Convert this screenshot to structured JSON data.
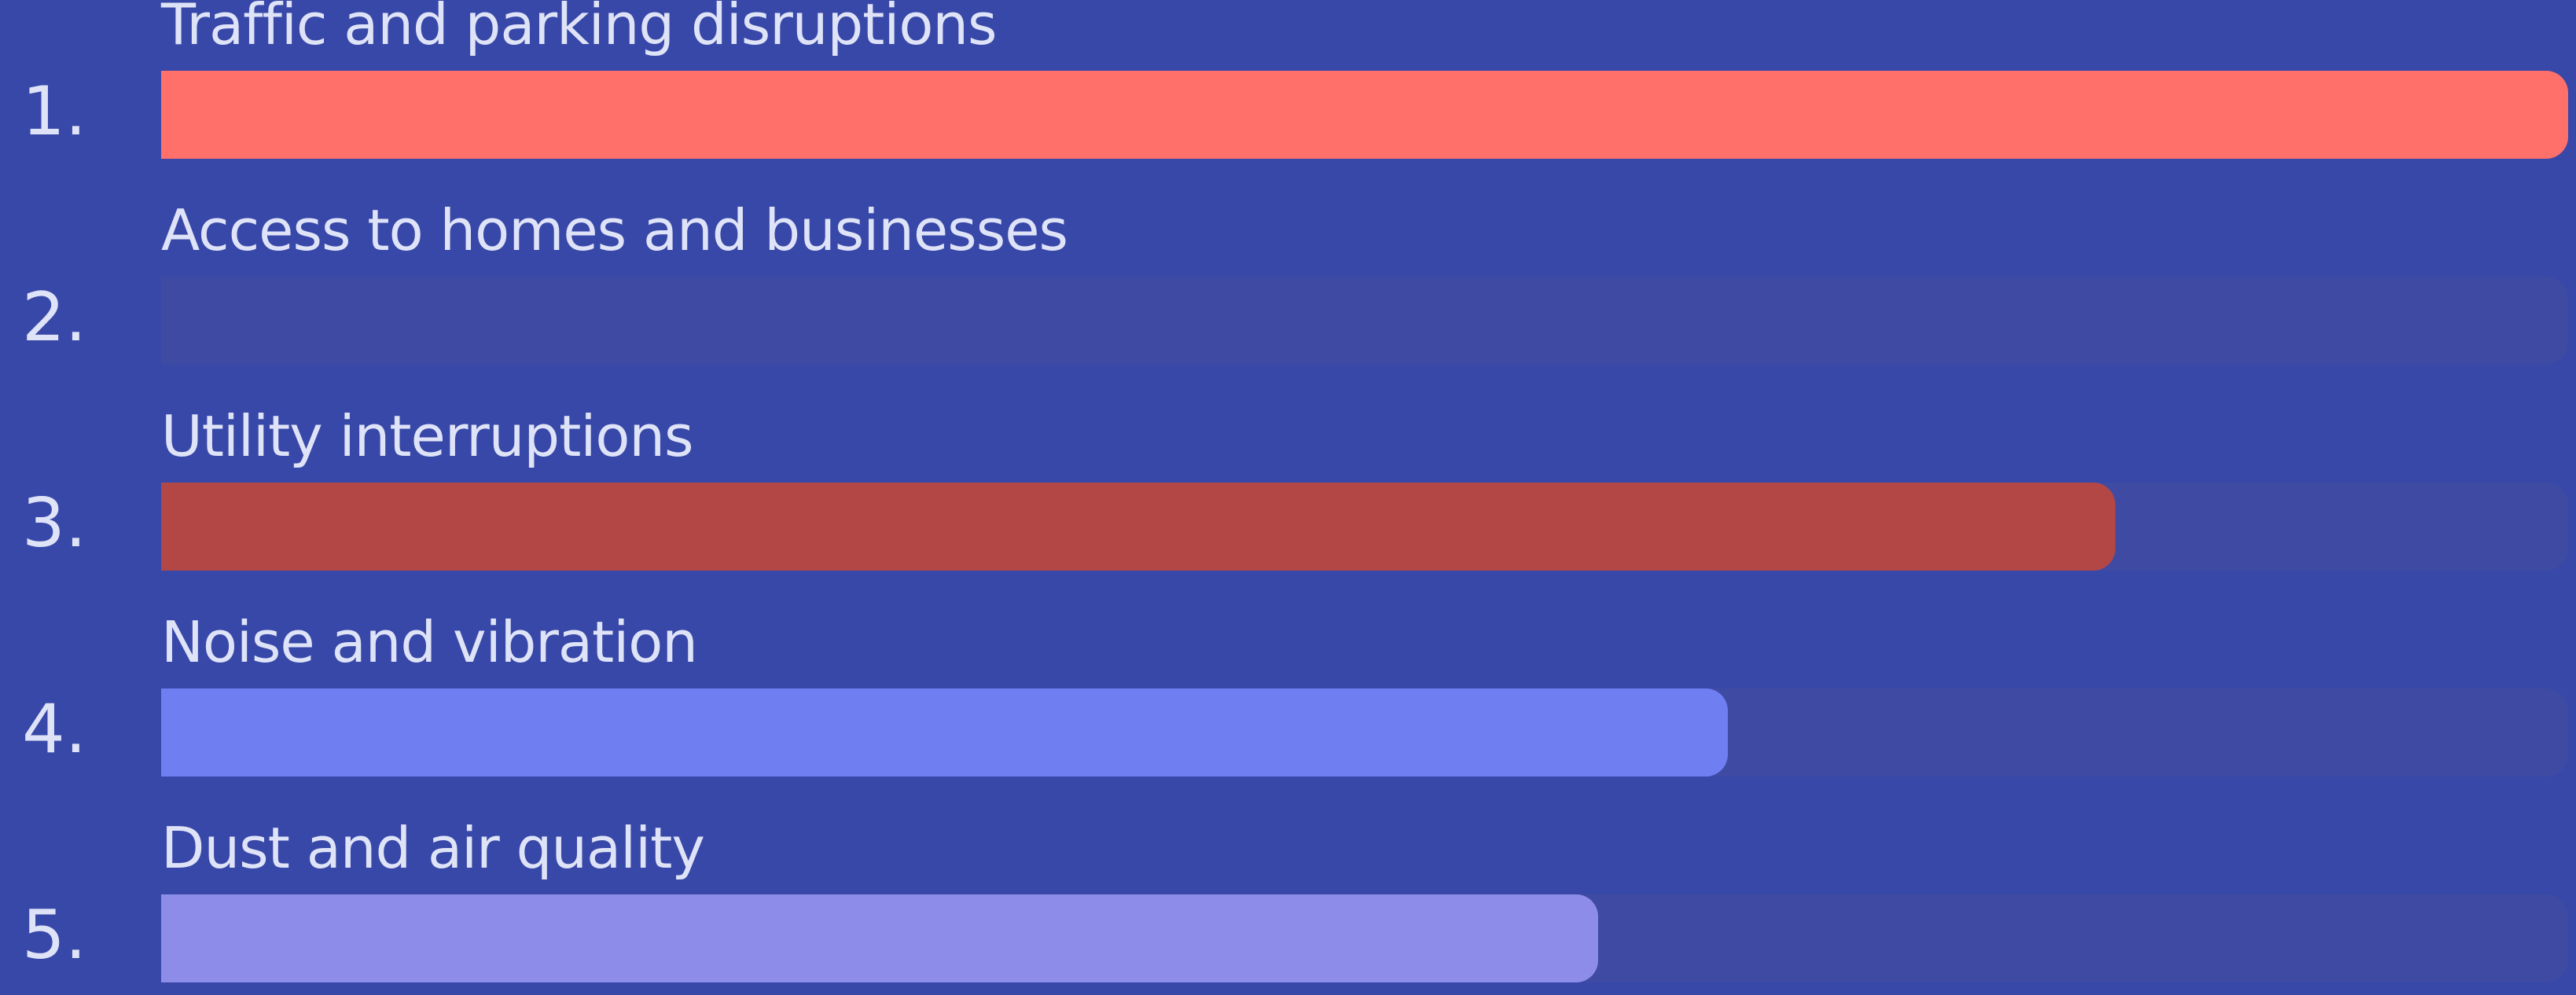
{
  "chart_data": {
    "type": "bar",
    "orientation": "horizontal",
    "ranks": [
      "1.",
      "2.",
      "3.",
      "4.",
      "5."
    ],
    "categories": [
      "Traffic and parking disruptions",
      "Access to homes and businesses",
      "Utility interruptions",
      "Noise and vibration",
      "Dust and air quality"
    ],
    "values": [
      100,
      0,
      81.2,
      65.1,
      59.7
    ],
    "xlim": [
      0,
      100
    ],
    "colors": [
      "#ff706b",
      "#3848a8",
      "#b34746",
      "#6f7ff2",
      "#8d8ce8"
    ],
    "track_color": "#3f4ba3",
    "grid": false
  }
}
